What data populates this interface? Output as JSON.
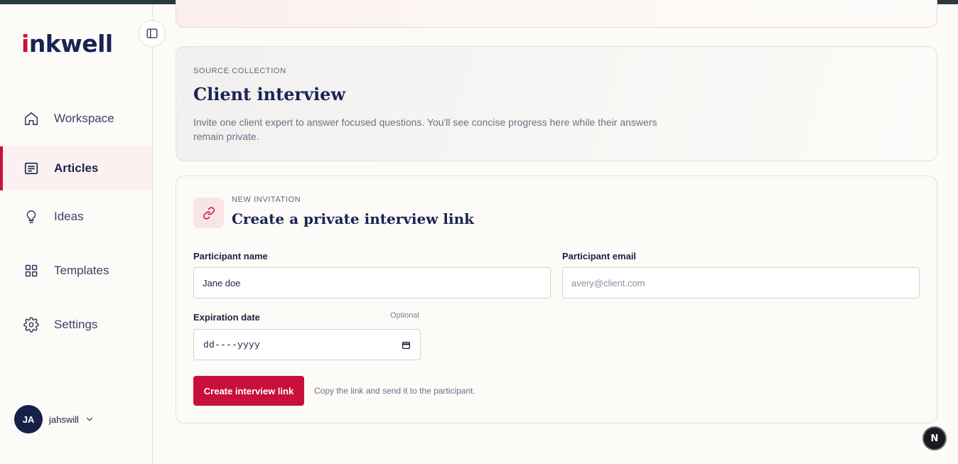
{
  "app": {
    "logo_text_start": "i",
    "logo_text_rest": "nkwell",
    "brand_color": "#c8103b",
    "navy_color": "#1a2352"
  },
  "sidebar": {
    "collapse_icon": "sidebar-toggle-icon",
    "items": [
      {
        "label": "Workspace",
        "icon": "home-icon",
        "active": false
      },
      {
        "label": "Articles",
        "icon": "articles-icon",
        "active": true
      },
      {
        "label": "Ideas",
        "icon": "lightbulb-icon",
        "active": false
      },
      {
        "label": "Templates",
        "icon": "grid-icon",
        "active": false
      },
      {
        "label": "Settings",
        "icon": "gear-icon",
        "active": false
      }
    ],
    "user": {
      "initials": "JA",
      "name": "jahswill"
    }
  },
  "source_card": {
    "eyebrow": "SOURCE COLLECTION",
    "title": "Client interview",
    "description": "Invite one client expert to answer focused questions. You'll see concise progress here while their answers remain private."
  },
  "invite_card": {
    "eyebrow": "NEW INVITATION",
    "title": "Create a private interview link",
    "icon": "link-icon",
    "name_label": "Participant name",
    "name_value": "Jane doe",
    "email_label": "Participant email",
    "email_placeholder": "avery@client.com",
    "expiration_label": "Expiration date",
    "expiration_optional": "Optional",
    "expiration_value": "dd----yyyy",
    "submit_label": "Create interview link",
    "hint": "Copy the link and send it to the participant."
  },
  "badge": {
    "letter": "N"
  }
}
